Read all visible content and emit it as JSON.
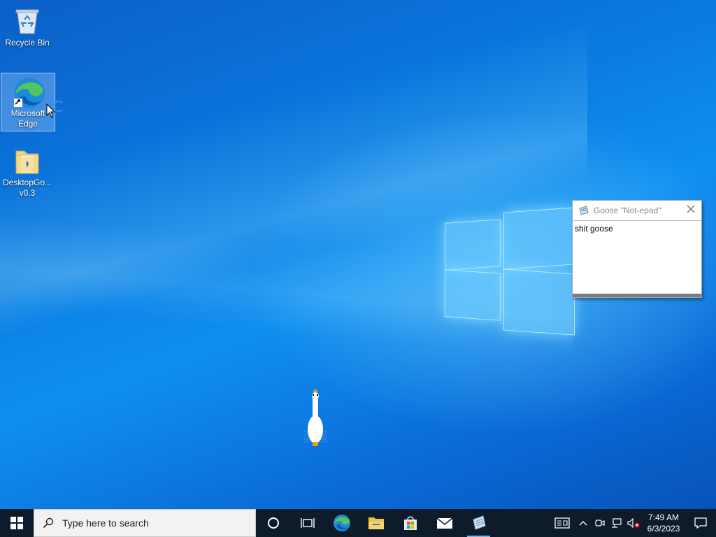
{
  "desktop": {
    "icons": [
      {
        "label": "Recycle Bin"
      },
      {
        "label": "Microsoft Edge"
      },
      {
        "label": "DesktopGo... v0.3"
      }
    ]
  },
  "goose_window": {
    "title": "Goose \"Not-epad\"",
    "text": "shit goose"
  },
  "taskbar": {
    "search_placeholder": "Type here to search",
    "apps": [
      "task-view",
      "edge",
      "file-explorer",
      "microsoft-store",
      "mail",
      "goose-notepad"
    ],
    "clock": {
      "time": "7:49 AM",
      "date": "6/3/2023"
    }
  },
  "colors": {
    "taskbar": "#0d1b2a",
    "desktop_blue": "#0a7be0",
    "accent": "#7fb2e5"
  }
}
